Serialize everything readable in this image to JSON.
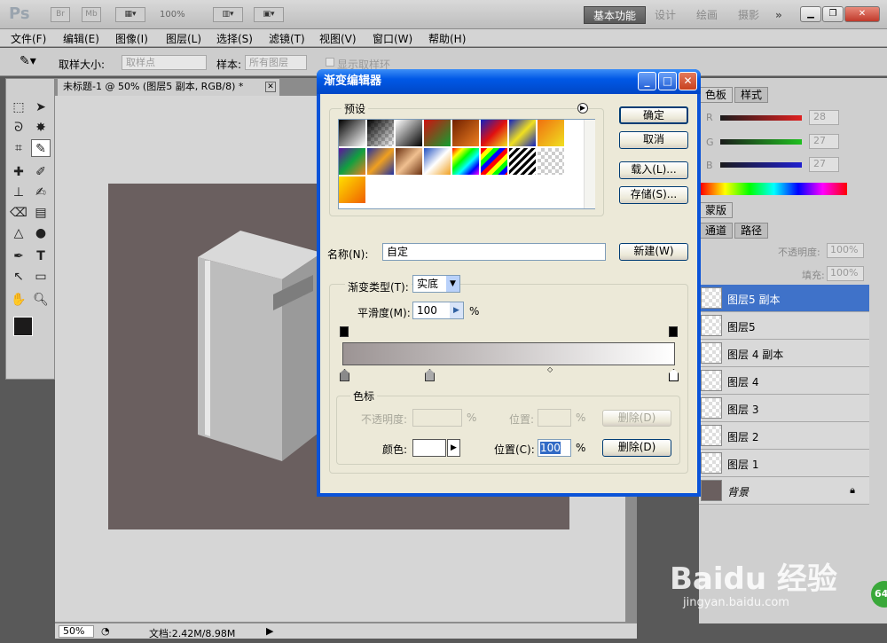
{
  "app": {
    "logo": "Ps",
    "bridge_label": "Br",
    "minibridge_label": "Mb",
    "zoom": "100%",
    "workspaces": [
      "基本功能",
      "设计",
      "绘画",
      "摄影"
    ],
    "more": "»"
  },
  "menu": [
    "文件(F)",
    "编辑(E)",
    "图像(I)",
    "图层(L)",
    "选择(S)",
    "滤镜(T)",
    "视图(V)",
    "窗口(W)",
    "帮助(H)"
  ],
  "options": {
    "sample_size_label": "取样大小:",
    "sample_size_value": "取样点",
    "sample_label": "样本:",
    "sample_value": "所有图层",
    "show_ring": "显示取样环"
  },
  "document": {
    "tab_title": "未标题-1 @ 50% (图层5 副本, RGB/8) *",
    "zoom": "50%",
    "doc_info": "文档:2.42M/8.98M",
    "canvas_color": "#6a5f5f"
  },
  "panels": {
    "top_tabs": [
      "色板",
      "样式"
    ],
    "rgb": [
      {
        "ch": "R",
        "val": "28"
      },
      {
        "ch": "G",
        "val": "27"
      },
      {
        "ch": "B",
        "val": "27"
      }
    ],
    "mid_tab": "蒙版",
    "layer_tabs": [
      "通道",
      "路径"
    ],
    "opacity_label": "不透明度:",
    "opacity_value": "100%",
    "fill_label": "填充:",
    "fill_value": "100%",
    "layers": [
      {
        "name": "图层5 副本",
        "selected": true
      },
      {
        "name": "图层5",
        "selected": false
      },
      {
        "name": "图层 4 副本",
        "selected": false
      },
      {
        "name": "图层 4",
        "selected": false
      },
      {
        "name": "图层 3",
        "selected": false
      },
      {
        "name": "图层 2",
        "selected": false
      },
      {
        "name": "图层 1",
        "selected": false
      },
      {
        "name": "背景",
        "selected": false
      }
    ]
  },
  "dialog": {
    "title": "渐变编辑器",
    "presets_label": "预设",
    "ok": "确定",
    "cancel": "取消",
    "load": "载入(L)...",
    "save": "存储(S)...",
    "name_label": "名称(N):",
    "name_value": "自定",
    "new_button": "新建(W)",
    "type_label": "渐变类型(T):",
    "type_value": "实底",
    "smooth_label": "平滑度(M):",
    "smooth_value": "100",
    "percent": "%",
    "stops_label": "色标",
    "opacity_label": "不透明度:",
    "position_label": "位置:",
    "delete_label": "删除(D)",
    "color_label": "颜色:",
    "position2_label": "位置(C):",
    "position2_value": "100",
    "gradient_from": "#9c9494",
    "gradient_to": "#ffffff"
  },
  "watermark": {
    "main": "Baidu 经验",
    "sub": "jingyan.baidu.com",
    "badge": "64"
  }
}
